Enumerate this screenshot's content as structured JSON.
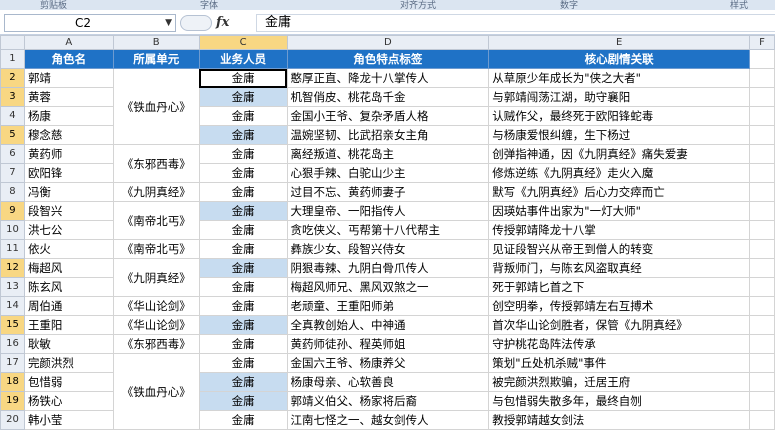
{
  "formula_bar": {
    "cell_ref": "C2",
    "content": "金庸"
  },
  "column_letters": [
    "A",
    "B",
    "C",
    "D",
    "E",
    "F"
  ],
  "headers": [
    "角色名",
    "所属单元",
    "业务人员",
    "角色特点标签",
    "核心剧情关联"
  ],
  "rows": [
    {
      "num": "2",
      "name": "郭靖",
      "staff": "金庸",
      "tag": "憨厚正直、降龙十八掌传人",
      "plot": "从草原少年成长为\"侠之大者\""
    },
    {
      "num": "3",
      "name": "黄蓉",
      "staff": "金庸",
      "tag": "机智俏皮、桃花岛千金",
      "plot": "与郭靖闯荡江湖，助守襄阳"
    },
    {
      "num": "4",
      "name": "杨康",
      "staff": "金庸",
      "tag": "金国小王爷、复杂矛盾人格",
      "plot": "认贼作父，最终死于欧阳锋蛇毒"
    },
    {
      "num": "5",
      "name": "穆念慈",
      "staff": "金庸",
      "tag": "温婉坚韧、比武招亲女主角",
      "plot": "与杨康爱恨纠缠，生下杨过"
    },
    {
      "num": "6",
      "name": "黄药师",
      "staff": "金庸",
      "tag": "离经叛道、桃花岛主",
      "plot": "创弹指神通，因《九阴真经》痛失爱妻"
    },
    {
      "num": "7",
      "name": "欧阳锋",
      "staff": "金庸",
      "tag": "心狠手辣、白驼山少主",
      "plot": "修炼逆练《九阴真经》走火入魔"
    },
    {
      "num": "8",
      "name": "冯衡",
      "staff": "金庸",
      "tag": "过目不忘、黄药师妻子",
      "plot": "默写《九阴真经》后心力交瘁而亡"
    },
    {
      "num": "9",
      "name": "段智兴",
      "staff": "金庸",
      "tag": "大理皇帝、一阳指传人",
      "plot": "因瑛姑事件出家为\"一灯大师\""
    },
    {
      "num": "10",
      "name": "洪七公",
      "staff": "金庸",
      "tag": "贪吃侠义、丐帮第十八代帮主",
      "plot": "传授郭靖降龙十八掌"
    },
    {
      "num": "11",
      "name": "依火",
      "staff": "金庸",
      "tag": "彝族少女、段智兴侍女",
      "plot": "见证段智兴从帝王到僧人的转变"
    },
    {
      "num": "12",
      "name": "梅超风",
      "staff": "金庸",
      "tag": "阴狠毒辣、九阴白骨爪传人",
      "plot": "背叛师门，与陈玄风盗取真经"
    },
    {
      "num": "13",
      "name": "陈玄风",
      "staff": "金庸",
      "tag": "梅超风师兄、黑风双煞之一",
      "plot": "死于郭靖匕首之下"
    },
    {
      "num": "14",
      "name": "周伯通",
      "staff": "金庸",
      "tag": "老顽童、王重阳师弟",
      "plot": "创空明拳，传授郭靖左右互搏术"
    },
    {
      "num": "15",
      "name": "王重阳",
      "staff": "金庸",
      "tag": "全真教创始人、中神通",
      "plot": "首次华山论剑胜者，保管《九阴真经》"
    },
    {
      "num": "16",
      "name": "耿敏",
      "staff": "金庸",
      "tag": "黄药师徒孙、程英师姐",
      "plot": "守护桃花岛阵法传承"
    },
    {
      "num": "17",
      "name": "完颜洪烈",
      "staff": "金庸",
      "tag": "金国六王爷、杨康养父",
      "plot": "策划\"丘处机杀贼\"事件"
    },
    {
      "num": "18",
      "name": "包惜弱",
      "staff": "金庸",
      "tag": "杨康母亲、心软善良",
      "plot": "被完颜洪烈欺骗，迁居王府"
    },
    {
      "num": "19",
      "name": "杨铁心",
      "staff": "金庸",
      "tag": "郭靖义伯父、杨家将后裔",
      "plot": "与包惜弱失散多年，最终自刎"
    },
    {
      "num": "20",
      "name": "韩小莹",
      "staff": "金庸",
      "tag": "江南七怪之一、越女剑传人",
      "plot": "教授郭靖越女剑法"
    }
  ],
  "units": [
    {
      "label": "《铁血丹心》"
    },
    {
      "label": "《东邪西毒》"
    },
    {
      "label": "《九阴真经》"
    },
    {
      "label": "《南帝北丐》"
    },
    {
      "label": "《南帝北丐》"
    },
    {
      "label": "《九阴真经》"
    },
    {
      "label": "《华山论剑》"
    },
    {
      "label": "《华山论剑》"
    },
    {
      "label": "《东邪西毒》"
    },
    {
      "label": "《铁血丹心》"
    }
  ]
}
